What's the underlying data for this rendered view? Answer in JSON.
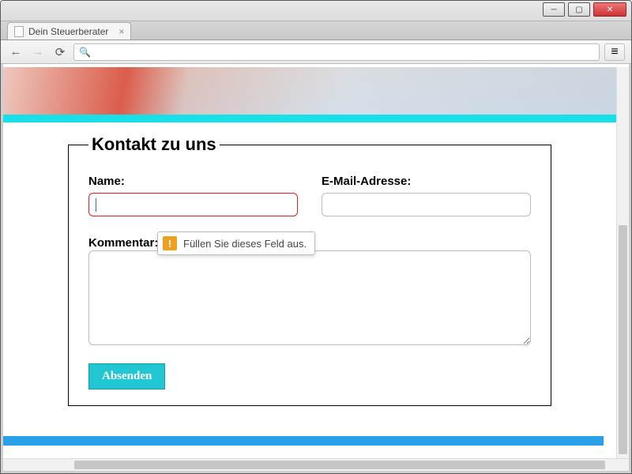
{
  "browser": {
    "tab_title": "Dein Steuerberater",
    "url": ""
  },
  "form": {
    "legend": "Kontakt zu uns",
    "name_label": "Name:",
    "name_value": "",
    "email_label": "E-Mail-Adresse:",
    "email_value": "",
    "comment_label": "Kommentar:",
    "comment_value": "",
    "submit_label": "Absenden"
  },
  "validation": {
    "message": "Füllen Sie dieses Feld aus."
  }
}
